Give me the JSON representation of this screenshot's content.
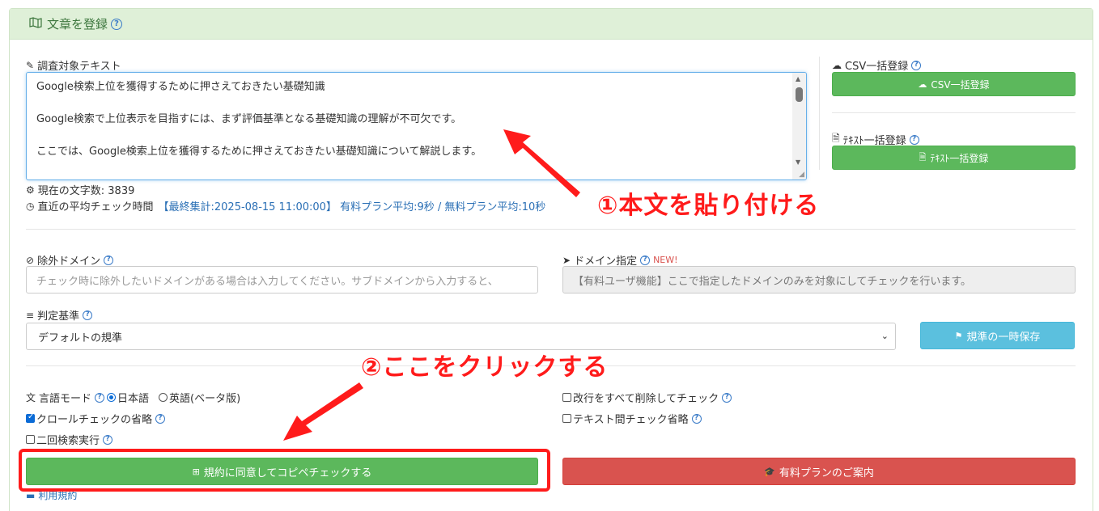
{
  "panel": {
    "title": "文章を登録"
  },
  "target_text": {
    "label": "調査対象テキスト",
    "lines": [
      "Google検索上位を獲得するために押さえておきたい基礎知識",
      "Google検索で上位表示を目指すには、まず評価基準となる基礎知識の理解が不可欠です。",
      "ここでは、Google検索上位を獲得するために押さえておきたい基礎知識について解説します。"
    ],
    "char_count": "現在の文字数: 3839",
    "avg_check_label": "直近の平均チェック時間",
    "avg_check_stats": "【最終集計:2025-08-15 11:00:00】 有料プラン平均:9秒 / 無料プラン平均:10秒"
  },
  "csv": {
    "label": "CSV一括登録",
    "button": "CSV一括登録"
  },
  "text_bulk": {
    "label": "ﾃｷｽﾄ一括登録",
    "button": "ﾃｷｽﾄ一括登録"
  },
  "exclude_domain": {
    "label": "除外ドメイン",
    "placeholder": "チェック時に除外したいドメインがある場合は入力してください。サブドメインから入力すると、"
  },
  "domain_spec": {
    "label": "ドメイン指定",
    "badge": "NEW!",
    "placeholder": "【有料ユーザ機能】ここで指定したドメインのみを対象にしてチェックを行います。"
  },
  "criteria": {
    "label": "判定基準",
    "selected": "デフォルトの規準",
    "save_button": "規準の一時保存"
  },
  "options": {
    "language_label": "言語モード",
    "lang_ja": "日本語",
    "lang_en": "英語(ベータ版)",
    "crawl_skip": "クロールチェックの省略",
    "double_search": "二回検索実行",
    "remove_newlines": "改行をすべて削除してチェック",
    "text_compare_skip": "テキスト間チェック省略"
  },
  "actions": {
    "check_button": "規約に同意してコピペチェックする",
    "paid_button": "有料プランのご案内",
    "terms_link": "利用規約"
  },
  "annotations": {
    "step1": "①本文を貼り付ける",
    "step2": "②ここをクリックする"
  },
  "colors": {
    "green": "#5cb85c",
    "info": "#5bc0de",
    "red": "#d9534f",
    "annotation": "#ff1b1b",
    "header_bg": "#dff0d8"
  }
}
